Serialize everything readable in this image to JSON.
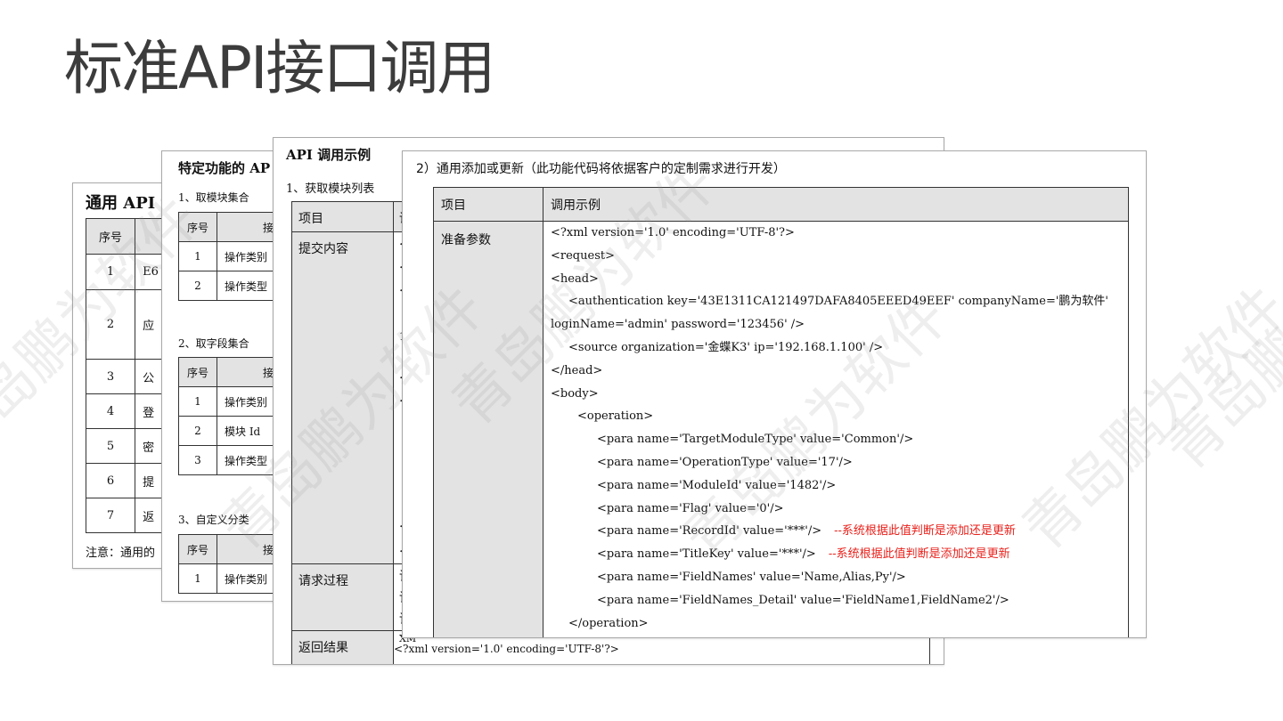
{
  "slide": {
    "title": "标准API接口调用"
  },
  "card1": {
    "heading": "通用 API 设",
    "header_col": "序号",
    "rows": [
      {
        "no": "1",
        "val": "E6"
      },
      {
        "no": "2",
        "val": "应"
      },
      {
        "no": "3",
        "val": "公"
      },
      {
        "no": "4",
        "val": "登"
      },
      {
        "no": "5",
        "val": "密"
      },
      {
        "no": "6",
        "val": "提"
      },
      {
        "no": "7",
        "val": "返"
      }
    ],
    "note": "注意：通用的"
  },
  "card2": {
    "heading": "特定功能的 AP",
    "sections": [
      {
        "title": "1、取模块集合",
        "cols": [
          "序号",
          "接口"
        ],
        "rows": [
          [
            "1",
            "操作类别"
          ],
          [
            "2",
            "操作类型"
          ]
        ]
      },
      {
        "title": "2、取字段集合",
        "cols": [
          "序号",
          "接口"
        ],
        "rows": [
          [
            "1",
            "操作类别"
          ],
          [
            "2",
            "模块 Id"
          ],
          [
            "3",
            "操作类型"
          ]
        ]
      },
      {
        "title": "3、自定义分类",
        "cols": [
          "序号",
          "接口"
        ],
        "rows": [
          [
            "1",
            "操作类别"
          ]
        ]
      }
    ]
  },
  "card3": {
    "heading": "API 调用示例",
    "subheading": "1、获取模块列表",
    "rows": [
      {
        "key": "项目",
        "frag": [
          "调"
        ]
      },
      {
        "key": "提交内容",
        "frag": [
          "<?",
          "<r",
          "<h",
          "",
          "1(",
          "",
          "</",
          "<b",
          "",
          "",
          "",
          "",
          "",
          "</",
          "</"
        ]
      },
      {
        "key": "请求过程",
        "frag": [
          "请",
          "请",
          "请"
        ]
      },
      {
        "key": "返回结果",
        "frag": [
          "XM"
        ]
      }
    ],
    "xml_line": "<?xml version='1.0' encoding='UTF-8'?>"
  },
  "card4": {
    "heading": "2）通用添加或更新（此功能代码将依据客户的定制需求进行开发）",
    "col1": "项目",
    "col2": "调用示例",
    "row_key": "准备参数",
    "lines": [
      {
        "indent": 0,
        "text": "<?xml version='1.0' encoding='UTF-8'?>",
        "note": ""
      },
      {
        "indent": 0,
        "text": "<request>",
        "note": ""
      },
      {
        "indent": 0,
        "text": "<head>",
        "note": ""
      },
      {
        "indent": 1,
        "text": "<authentication key='43E1311CA121497DAFA8405EEED49EEF' companyName='鹏为软件'",
        "note": ""
      },
      {
        "indent": 0,
        "text": "loginName='admin' password='123456' />",
        "note": ""
      },
      {
        "indent": 1,
        "text": "<source organization='金蝶K3' ip='192.168.1.100' />",
        "note": ""
      },
      {
        "indent": 0,
        "text": "</head>",
        "note": ""
      },
      {
        "indent": 0,
        "text": "<body>",
        "note": ""
      },
      {
        "indent": 2,
        "text": "<operation>",
        "note": ""
      },
      {
        "indent": 3,
        "text": "<para name='TargetModuleType' value='Common'/>",
        "note": ""
      },
      {
        "indent": 3,
        "text": "<para name='OperationType' value='17'/>",
        "note": ""
      },
      {
        "indent": 3,
        "text": "<para name='ModuleId' value='1482'/>",
        "note": ""
      },
      {
        "indent": 3,
        "text": "<para name='Flag' value='0'/>",
        "note": ""
      },
      {
        "indent": 3,
        "text": "<para name='RecordId' value='***'/>",
        "note": "--系统根据此值判断是添加还是更新"
      },
      {
        "indent": 3,
        "text": "<para name='TitleKey' value='***'/>",
        "note": "--系统根据此值判断是添加还是更新"
      },
      {
        "indent": 3,
        "text": "<para name='FieldNames' value='Name,Alias,Py'/>",
        "note": ""
      },
      {
        "indent": 3,
        "text": "<para name='FieldNames_Detail' value='FieldName1,FieldName2'/>",
        "note": ""
      },
      {
        "indent": 1,
        "text": "</operation>",
        "note": ""
      }
    ]
  },
  "watermark": {
    "text": "青岛鹏为软件"
  }
}
